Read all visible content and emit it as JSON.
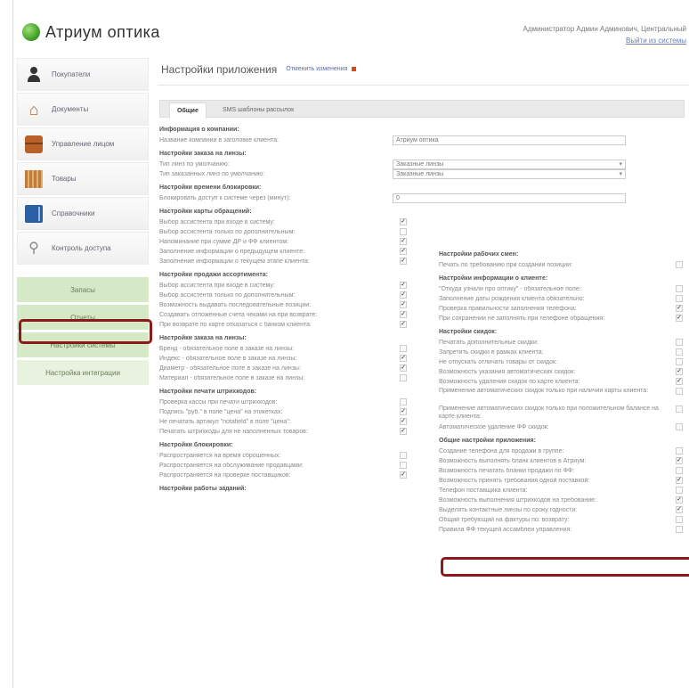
{
  "header": {
    "logo_text": "Атриум оптика",
    "user_line": "Администратор Админ Админович, Центральный",
    "logout": "Выйти из системы"
  },
  "sidebar": {
    "items": [
      {
        "label": "Покупатели",
        "icon": "person-icon"
      },
      {
        "label": "Документы",
        "icon": "house-icon"
      },
      {
        "label": "Управление лицом",
        "icon": "chest-icon"
      },
      {
        "label": "Товары",
        "icon": "books-icon"
      },
      {
        "label": "Справочники",
        "icon": "book-icon"
      },
      {
        "label": "Контроль доступа",
        "icon": "key-icon"
      }
    ],
    "sub_items": [
      "Запасы",
      "Отчеты",
      "Настройки системы",
      "Настройка интеграции"
    ]
  },
  "page": {
    "title": "Настройки приложения",
    "link": "Отменить изменения"
  },
  "tabs": [
    "Общие",
    "SMS шаблоны рассылок"
  ],
  "left_column": {
    "sections": [
      {
        "title": "Информация о компании:",
        "rows": [
          {
            "text": "Название компании в заголовке клиента:",
            "field": "Атриум оптика"
          }
        ]
      },
      {
        "title": "Настройки заказа на линзы:",
        "rows": [
          {
            "text": "Тип линз по умолчанию:",
            "select": "Заказные линзы"
          },
          {
            "text": "Тип заказанных линз по умолчанию:",
            "select": "Заказные линзы"
          }
        ]
      },
      {
        "title": "Настройки времени блокировки:",
        "rows": [
          {
            "text": "Блокировать доступ к системе через (минут):",
            "field": "0"
          }
        ]
      },
      {
        "title": "Настройки карты обращений:",
        "rows": [
          {
            "text": "Выбор ассистента при входе в систему:",
            "check": "✓"
          },
          {
            "text": "Выбор ассистента только по дополнительным:",
            "check": ""
          },
          {
            "text": "Напоминание при сумме ДР и ФФ клиентом:",
            "check": "✓"
          },
          {
            "text": "Заполнение информации о предыдущем клиенте:",
            "check": "✓"
          },
          {
            "text": "Заполнение информации о текущем этапе клиента:",
            "check": "✓"
          }
        ]
      },
      {
        "title": "Настройки продажи ассортимента:",
        "rows": [
          {
            "text": "Выбор ассистента при входе в систему:",
            "check": "✓"
          },
          {
            "text": "Выбор ассистента только по дополнительным:",
            "check": "✓"
          },
          {
            "text": "Возможность выдавать последовательные позиции:",
            "check": "✓"
          },
          {
            "text": "Создавать отложенные счета чеками на при возврате:",
            "check": "✓"
          },
          {
            "text": "При возврате по карте отказаться с банком клиента:",
            "check": "✓"
          }
        ]
      },
      {
        "title": "Настройки заказа на линзы:",
        "rows": [
          {
            "text": "Бренд - обязательное поле в заказе на линзы:",
            "check": ""
          },
          {
            "text": "Индекс - обязательное поле в заказе на линзы:",
            "check": "✓"
          },
          {
            "text": "Диаметр - обязательное поле в заказе на линзы:",
            "check": "✓"
          },
          {
            "text": "Материал - обязательное поле в заказе на линзы:",
            "check": ""
          }
        ]
      },
      {
        "title": "Настройки печати штрихкодов:",
        "rows": [
          {
            "text": "Проверка кассы при печати штрихкодов:",
            "check": ""
          },
          {
            "text": "Подпись \"руб.\" в поле \"цена\" на этикетках:",
            "check": "✓"
          },
          {
            "text": "Не печатать артикул \"notafield\" в поле \"цена\":",
            "check": "✓"
          },
          {
            "text": "Печатать штрихкоды для не наполненных товаров:",
            "check": "✓"
          }
        ]
      },
      {
        "title": "Настройки блокировки:",
        "rows": [
          {
            "text": "Распространяется на время сброшенных:",
            "check": ""
          },
          {
            "text": "Распространяется на обслуживание продавцами:",
            "check": ""
          },
          {
            "text": "Распространяется на проверке поставщиков:",
            "check": "✓"
          }
        ]
      },
      {
        "title": "Настройки работы заданий:",
        "rows": []
      }
    ]
  },
  "right_column": {
    "sections": [
      {
        "title": "Настройки рабочих смен:",
        "rows": [
          {
            "text": "Печать по требованию при создании позиции:",
            "check": ""
          }
        ]
      },
      {
        "title": "Настройки информации о клиенте:",
        "rows": [
          {
            "text": "\"Откуда узнали про оптику\" - обязательное поле:",
            "check": ""
          },
          {
            "text": "Заполнение даты рождения клиента обязательно:",
            "check": ""
          },
          {
            "text": "Проверка правильности заполнения телефона:",
            "check": "✓"
          },
          {
            "text": "При сохранении не заполнять при телефоне обращения:",
            "check": "✓"
          }
        ]
      },
      {
        "title": "Настройки скидок:",
        "rows": [
          {
            "text": "Печатать дополнительные скидки:",
            "check": ""
          },
          {
            "text": "Запретить скидки в рамках клиента:",
            "check": ""
          },
          {
            "text": "Не отпускать отличать товары от скидок:",
            "check": ""
          },
          {
            "text": "Возможность указания автоматических скидок:",
            "check": "✓"
          },
          {
            "text": "Возможность удаления скидок по карте клиента:",
            "check": "✓"
          },
          {
            "text": "Применение автоматических скидок только при наличии карты клиента:",
            "check": "",
            "tall": true
          },
          {
            "text": "Применение автоматических скидок только при положительном балансе на карте клиента:",
            "check": "",
            "tall": true
          },
          {
            "text": "Автоматическое удаление ФФ скидок:",
            "check": ""
          }
        ]
      },
      {
        "title": "Общие настройки приложения:",
        "rows": [
          {
            "text": "Создание телефона для продажи в группе:",
            "check": ""
          },
          {
            "text": "Возможность выполнять бланк клиентов в Атриум:",
            "check": "✓"
          },
          {
            "text": "Возможность печатать бланки продажи по ФФ:",
            "check": ""
          },
          {
            "text": "Возможность принять требования одной поставкой:",
            "check": "✓"
          },
          {
            "text": "Телефон поставщика клиента:",
            "check": ""
          },
          {
            "text": "Возможность выполнения штрихкодов на требование:",
            "check": "✓"
          },
          {
            "text": "Выделять контактные линзы по сроку годности:",
            "check": "✓"
          },
          {
            "text": "Общий требующий на фактуры по: возврату:",
            "check": ""
          },
          {
            "text": "Правила ФФ текущей ассамблеи управления:",
            "check": ""
          }
        ]
      }
    ]
  }
}
